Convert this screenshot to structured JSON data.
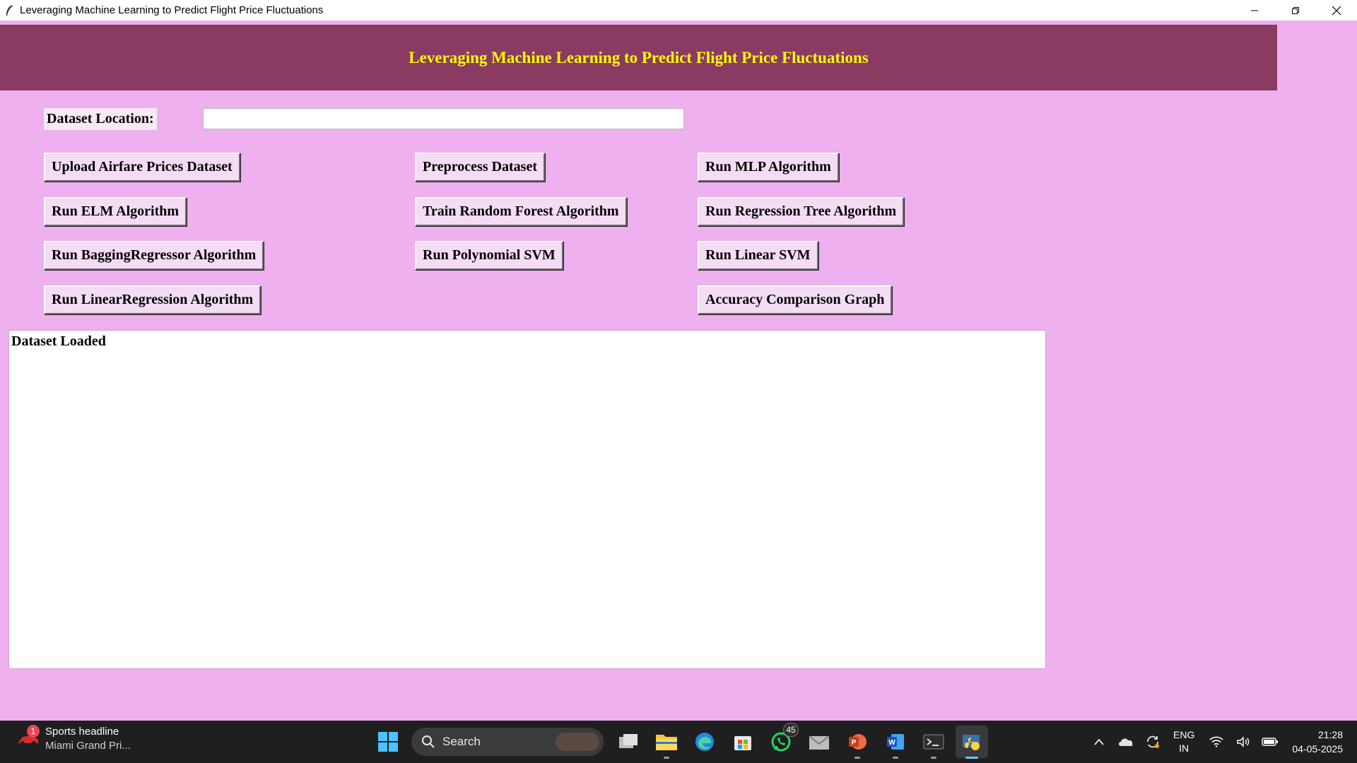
{
  "window": {
    "title": "Leveraging Machine Learning to Predict Flight Price Fluctuations",
    "controls": {
      "minimize": "minimize",
      "restore": "restore",
      "close": "close"
    }
  },
  "app": {
    "heading": "Leveraging Machine Learning to Predict Flight Price Fluctuations",
    "dataset_label": "Dataset Location:",
    "dataset_path_value": "",
    "buttons": {
      "upload": "Upload Airfare Prices Dataset",
      "preprocess": "Preprocess Dataset",
      "mlp": "Run MLP Algorithm",
      "elm": "Run ELM Algorithm",
      "random_forest": "Train Random Forest Algorithm",
      "regression_tree": "Run Regression Tree Algorithm",
      "bagging": "Run BaggingRegressor Algorithm",
      "poly_svm": "Run Polynomial SVM",
      "linear_svm": "Run Linear SVM",
      "linear_regression": "Run LinearRegression Algorithm",
      "accuracy_graph": "Accuracy Comparison Graph"
    },
    "output_text": "Dataset Loaded"
  },
  "taskbar": {
    "news": {
      "badge": "1",
      "headline": "Sports headline",
      "subtitle": "Miami Grand Pri..."
    },
    "search_label": "Search",
    "pinned": [
      "start-icon",
      "task-view-icon",
      "file-explorer-icon",
      "edge-icon",
      "store-icon",
      "whatsapp-icon",
      "mail-icon",
      "powerpoint-icon",
      "word-icon",
      "terminal-icon",
      "python-icon"
    ],
    "whatsapp_badge": "45",
    "language": {
      "line1": "ENG",
      "line2": "IN"
    },
    "clock": {
      "time": "21:28",
      "date": "04-05-2025"
    }
  },
  "colors": {
    "background": "#eeb0ee",
    "banner": "#8b3a62",
    "banner_text": "#ffff00",
    "taskbar": "#1f1f1f"
  }
}
